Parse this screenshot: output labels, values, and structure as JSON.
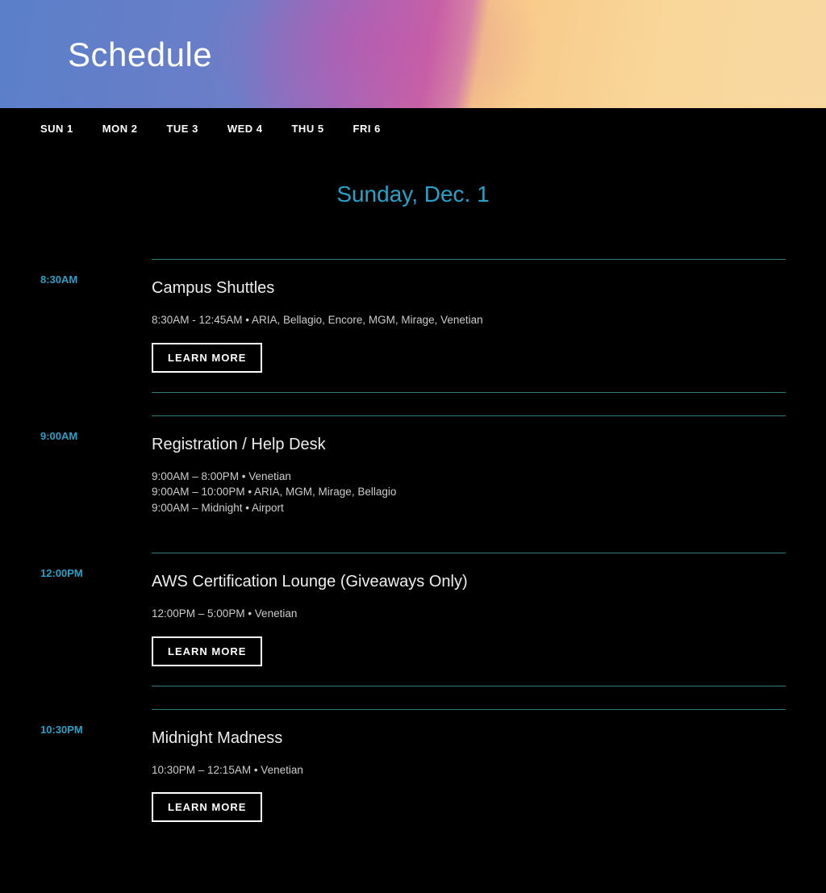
{
  "hero": {
    "title": "Schedule"
  },
  "daynav": [
    {
      "label": "SUN 1"
    },
    {
      "label": "MON 2"
    },
    {
      "label": "TUE 3"
    },
    {
      "label": "WED 4"
    },
    {
      "label": "THU 5"
    },
    {
      "label": "FRI 6"
    }
  ],
  "day_heading": "Sunday, Dec. 1",
  "learn_more_label": "LEARN MORE",
  "events": [
    {
      "time": "8:30AM",
      "title": "Campus Shuttles",
      "details": [
        "8:30AM - 12:45AM • ARIA, Bellagio, Encore, MGM, Mirage, Venetian"
      ],
      "has_button": true,
      "bottom_rule": true
    },
    {
      "time": "9:00AM",
      "title": "Registration / Help Desk",
      "details": [
        "9:00AM – 8:00PM • Venetian",
        "9:00AM – 10:00PM • ARIA, MGM, Mirage, Bellagio",
        "9:00AM – Midnight • Airport"
      ],
      "has_button": false,
      "bottom_rule": false
    },
    {
      "time": "12:00PM",
      "title": "AWS Certification Lounge (Giveaways Only)",
      "details": [
        "12:00PM – 5:00PM • Venetian"
      ],
      "has_button": true,
      "bottom_rule": true
    },
    {
      "time": "10:30PM",
      "title": "Midnight Madness",
      "details": [
        "10:30PM – 12:15AM • Venetian"
      ],
      "has_button": true,
      "bottom_rule": false
    }
  ]
}
